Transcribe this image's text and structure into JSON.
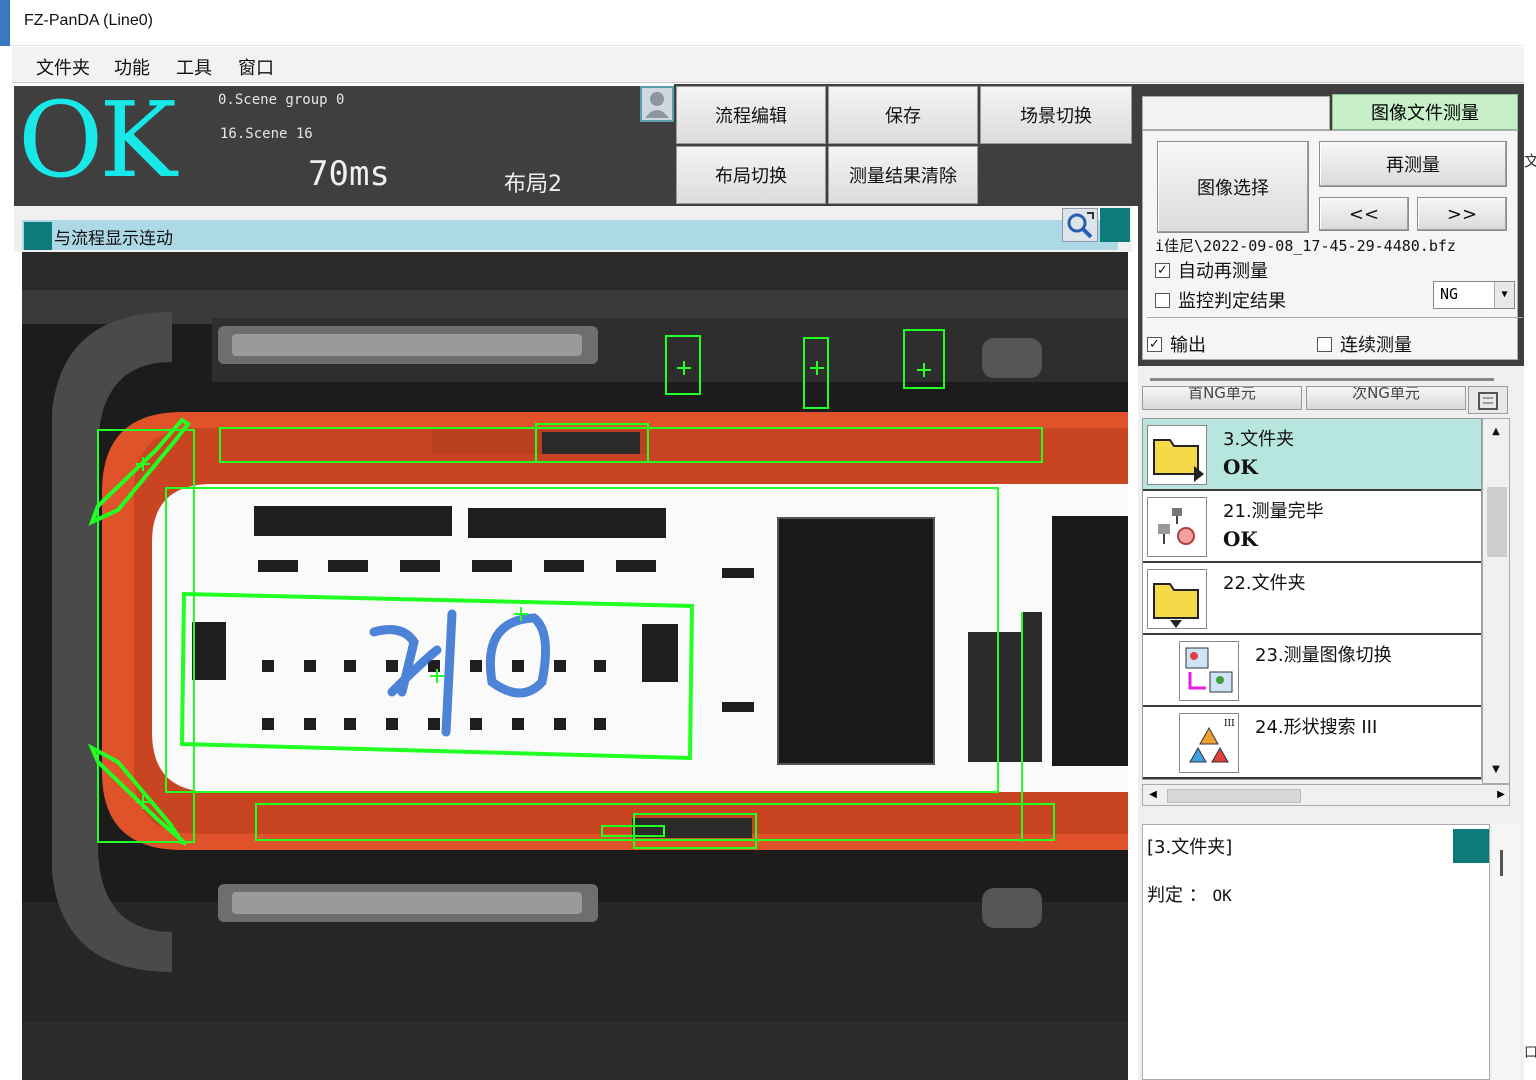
{
  "window": {
    "title": "FZ-PanDA (Line0)"
  },
  "menu": [
    "文件夹",
    "功能",
    "工具",
    "窗口"
  ],
  "status": {
    "result": "OK",
    "scene_group": "0.Scene group 0",
    "scene": "16.Scene 16",
    "time": "70ms",
    "layout": "布局2"
  },
  "toolbar": {
    "flow_edit": "流程编辑",
    "save": "保存",
    "scene_switch": "场景切换",
    "layout_switch": "布局切换",
    "clear_results": "测量结果清除"
  },
  "view": {
    "link_label": "与流程显示连动"
  },
  "measure_panel": {
    "tab_active": "图像文件测量",
    "select_image": "图像选择",
    "remeasure": "再测量",
    "prev": "<<",
    "next": ">>",
    "file_path": "i佳尼\\2022-09-08_17-45-29-4480.bfz",
    "auto_remeasure": "自动再测量",
    "monitor_result": "监控判定结果",
    "monitor_select": "NG",
    "output": "输出",
    "continuous": "连续测量"
  },
  "ng_buttons": [
    "首NG单元",
    "次NG单元"
  ],
  "flow_list": [
    {
      "name": "3.文件夹",
      "status": "OK",
      "icon": "folder-icon",
      "selected": true
    },
    {
      "name": "21.测量完毕",
      "status": "OK",
      "icon": "measure-end-icon",
      "selected": false
    },
    {
      "name": "22.文件夹",
      "status": "",
      "icon": "folder-icon",
      "selected": false
    },
    {
      "name": "23.测量图像切换",
      "status": "",
      "icon": "image-switch-icon",
      "selected": false
    },
    {
      "name": "24.形状搜索 III",
      "status": "",
      "icon": "shape-search-icon",
      "selected": false
    }
  ],
  "detail": {
    "header": "[3.文件夹]",
    "judge_label": "判定 ：",
    "judge_value": "OK"
  },
  "edge_text": {
    "top": "文",
    "bottom": "口"
  },
  "colors": {
    "ok_text": "#18e8e8",
    "status_bg": "#3f3f3f",
    "active_tab": "#c8f0c8",
    "selected_row": "#b6e6dd",
    "teal_marker": "#0e7b7b",
    "roi_green": "#22ff22",
    "gasket_orange": "#e0522a"
  }
}
